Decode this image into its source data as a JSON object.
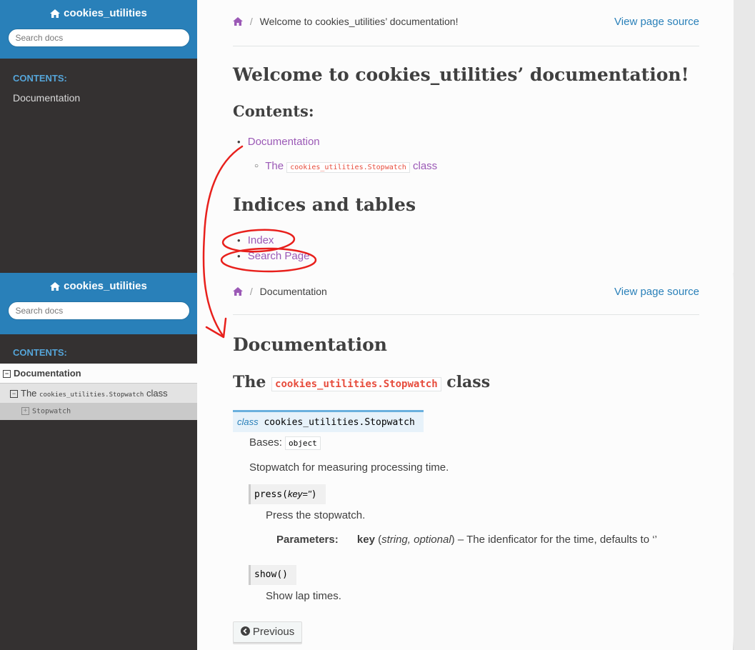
{
  "project_title": "cookies_utilities",
  "search_placeholder": "Search docs",
  "contents_label": "CONTENTS:",
  "page1": {
    "sidebar_item": "Documentation",
    "breadcrumb_current": "Welcome to cookies_utilities’ documentation!",
    "view_source": "View page source",
    "title": "Welcome to cookies_utilities’ documentation!",
    "contents_heading": "Contents:",
    "toc_item": "Documentation",
    "toc_sub_prefix": "The",
    "toc_sub_code": "cookies_utilities.Stopwatch",
    "toc_sub_suffix": "class",
    "indices_heading": "Indices and tables",
    "index_link": "Index",
    "search_link": "Search Page"
  },
  "page2": {
    "nav_current": "Documentation",
    "nav_l2_prefix": "The",
    "nav_l2_code": "cookies_utilities.Stopwatch",
    "nav_l2_suffix": "class",
    "nav_l3": "Stopwatch",
    "breadcrumb_current": "Documentation",
    "view_source": "View page source",
    "title": "Documentation",
    "section_prefix": "The",
    "section_code": "cookies_utilities.Stopwatch",
    "section_suffix": "class",
    "sig_keyword": "class",
    "sig_name": "cookies_utilities.Stopwatch",
    "bases_label": "Bases:",
    "bases_value": "object",
    "description": "Stopwatch for measuring processing time.",
    "press_name": "press",
    "press_params": "key=''",
    "press_desc": "Press the stopwatch.",
    "param_label": "Parameters:",
    "param_name": "key",
    "param_type": "string, optional",
    "param_desc": "– The idenficator for the time, defaults to ‘’",
    "show_name": "show",
    "show_desc": "Show lap times.",
    "previous_button": "Previous"
  },
  "colors": {
    "sidebar_header": "#2980b9",
    "sidebar_bg": "#343131",
    "link_visited": "#9b59b6",
    "link": "#2980b9",
    "annotation_red": "#e8201c"
  },
  "icons": [
    "home-icon",
    "chevron-circle-left-icon",
    "minus-square-icon",
    "plus-square-icon"
  ]
}
